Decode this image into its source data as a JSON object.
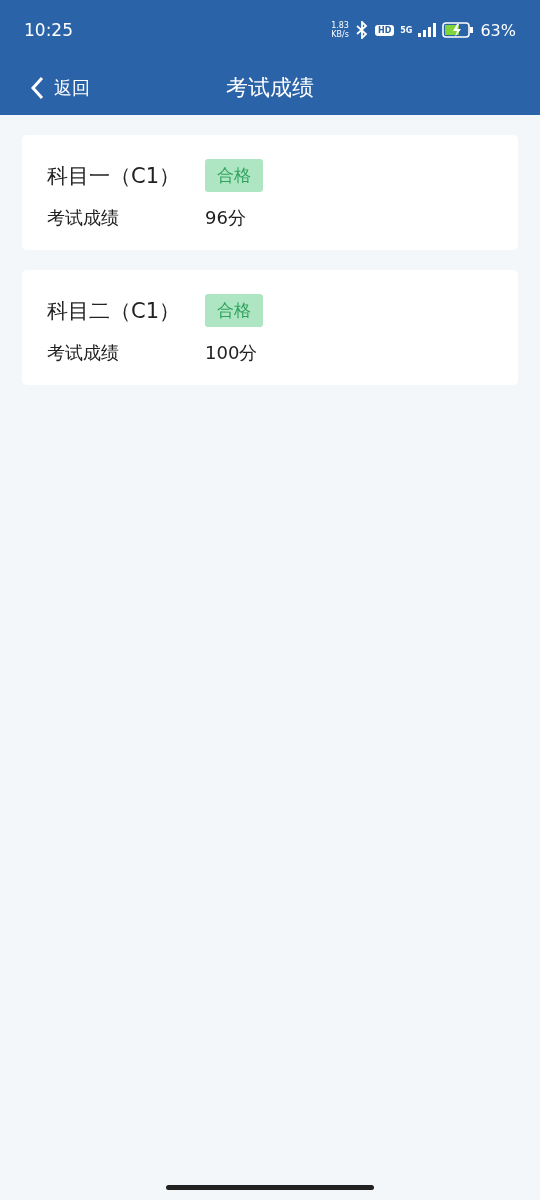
{
  "status_bar": {
    "time": "10:25",
    "net_speed": "1.83",
    "net_unit": "KB/s",
    "hd": "HD",
    "network": "5G",
    "battery": "63%"
  },
  "header": {
    "back": "返回",
    "title": "考试成绩"
  },
  "results": [
    {
      "subject": "科目一（C1）",
      "badge": "合格",
      "label": "考试成绩",
      "score": "96分"
    },
    {
      "subject": "科目二（C1）",
      "badge": "合格",
      "label": "考试成绩",
      "score": "100分"
    }
  ]
}
